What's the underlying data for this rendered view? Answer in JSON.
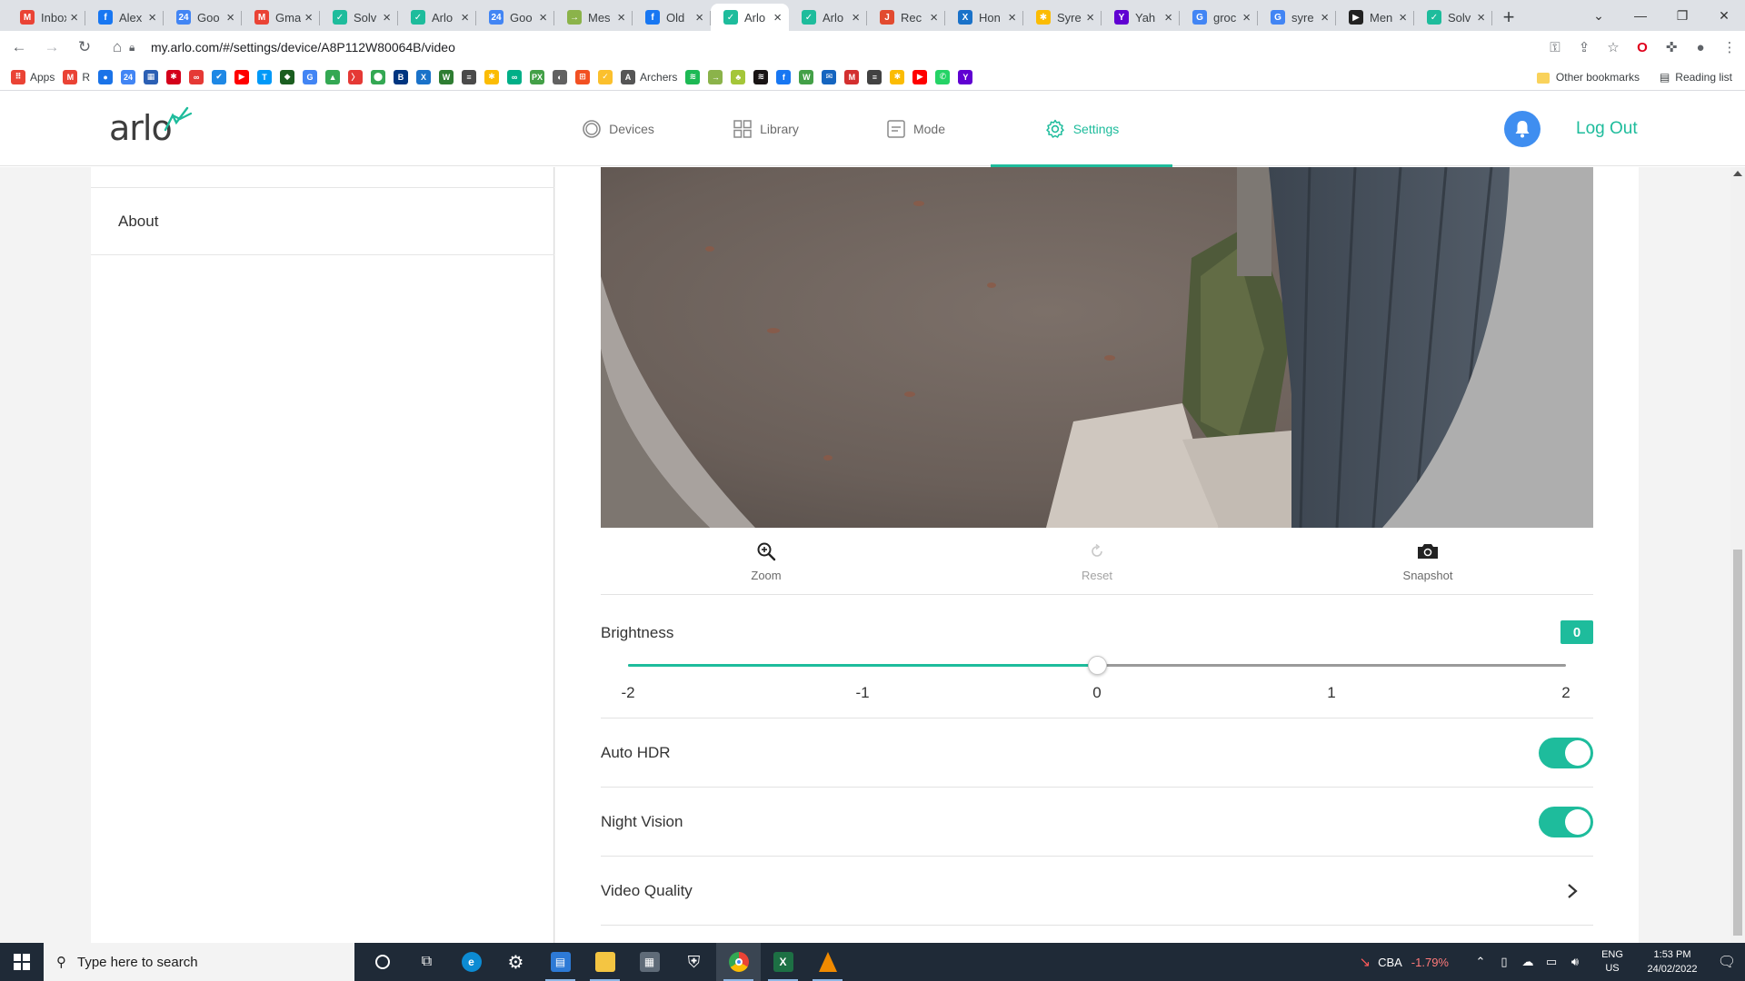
{
  "browser": {
    "tabs": [
      {
        "title": "Inbox",
        "icon": "gmail-icon",
        "color": "#ea4335",
        "glyph": "M"
      },
      {
        "title": "Alex",
        "icon": "facebook-icon",
        "color": "#1877f2",
        "glyph": "f"
      },
      {
        "title": "Goo",
        "icon": "calendar-icon",
        "color": "#4285f4",
        "glyph": "24"
      },
      {
        "title": "Gma",
        "icon": "gmail-icon",
        "color": "#ea4335",
        "glyph": "M"
      },
      {
        "title": "Solv",
        "icon": "arlo-icon",
        "color": "#1ebc9c",
        "glyph": "✓"
      },
      {
        "title": "Arlo",
        "icon": "arlo-icon",
        "color": "#1ebc9c",
        "glyph": "✓"
      },
      {
        "title": "Goo",
        "icon": "calendar-icon",
        "color": "#4285f4",
        "glyph": "24"
      },
      {
        "title": "Mes",
        "icon": "arlo-icon",
        "color": "#8bb34a",
        "glyph": "→"
      },
      {
        "title": "Old",
        "icon": "facebook-icon",
        "color": "#1877f2",
        "glyph": "f"
      },
      {
        "title": "Arlo",
        "icon": "arlo-icon",
        "color": "#1ebc9c",
        "glyph": "✓",
        "active": true
      },
      {
        "title": "Arlo",
        "icon": "arlo-icon",
        "color": "#1ebc9c",
        "glyph": "✓"
      },
      {
        "title": "Rec",
        "icon": "recipe-icon",
        "color": "#e24a2f",
        "glyph": "J"
      },
      {
        "title": "Hon",
        "icon": "xero-icon",
        "color": "#1a72c9",
        "glyph": "X"
      },
      {
        "title": "Syre",
        "icon": "photos-icon",
        "color": "#fbbc04",
        "glyph": "✱"
      },
      {
        "title": "Yah",
        "icon": "yahoo-icon",
        "color": "#6001d2",
        "glyph": "Y"
      },
      {
        "title": "groc",
        "icon": "google-icon",
        "color": "#4285f4",
        "glyph": "G"
      },
      {
        "title": "syre",
        "icon": "google-icon",
        "color": "#4285f4",
        "glyph": "G"
      },
      {
        "title": "Men",
        "icon": "menu-icon",
        "color": "#222222",
        "glyph": "▶"
      },
      {
        "title": "Solv",
        "icon": "arlo-icon",
        "color": "#1ebc9c",
        "glyph": "✓"
      }
    ],
    "url": "my.arlo.com/#/settings/device/A8P112W80064B/video",
    "bookmarks": [
      {
        "label": "Apps",
        "icon": "apps-grid-icon",
        "color": "#ea4335",
        "glyph": "⠿"
      },
      {
        "label": "R",
        "icon": "gmail-icon",
        "color": "#ea4335",
        "glyph": "M"
      },
      {
        "label": "",
        "icon": "bookmark-icon",
        "color": "#1a73e8",
        "glyph": "●"
      },
      {
        "label": "",
        "icon": "calendar-icon",
        "color": "#4285f4",
        "glyph": "24"
      },
      {
        "label": "",
        "icon": "bank-icon",
        "color": "#2b5fb4",
        "glyph": "▦"
      },
      {
        "label": "",
        "icon": "bookmark-icon",
        "color": "#d4001a",
        "glyph": "✱"
      },
      {
        "label": "",
        "icon": "bookmark-icon",
        "color": "#e53935",
        "glyph": "∞"
      },
      {
        "label": "",
        "icon": "todo-icon",
        "color": "#1e88e5",
        "glyph": "✔"
      },
      {
        "label": "",
        "icon": "youtube-icon",
        "color": "#ff0000",
        "glyph": "▶"
      },
      {
        "label": "",
        "icon": "telstra-icon",
        "color": "#0099f8",
        "glyph": "T"
      },
      {
        "label": "",
        "icon": "bookmark-icon",
        "color": "#1b5e20",
        "glyph": "◆"
      },
      {
        "label": "",
        "icon": "google-icon",
        "color": "#4285f4",
        "glyph": "G"
      },
      {
        "label": "",
        "icon": "drive-icon",
        "color": "#34a853",
        "glyph": "▲"
      },
      {
        "label": "",
        "icon": "bookmark-icon",
        "color": "#e53935",
        "glyph": "〉"
      },
      {
        "label": "",
        "icon": "maps-icon",
        "color": "#34a853",
        "glyph": "⬤"
      },
      {
        "label": "",
        "icon": "booking-icon",
        "color": "#003580",
        "glyph": "B"
      },
      {
        "label": "",
        "icon": "xero-icon",
        "color": "#1a72c9",
        "glyph": "X"
      },
      {
        "label": "",
        "icon": "bookmark-icon",
        "color": "#2e7d32",
        "glyph": "W"
      },
      {
        "label": "",
        "icon": "bookmark-icon",
        "color": "#4a4a4a",
        "glyph": "≡"
      },
      {
        "label": "",
        "icon": "photos-icon",
        "color": "#fbbc04",
        "glyph": "✱"
      },
      {
        "label": "",
        "icon": "tripadvisor-icon",
        "color": "#00af87",
        "glyph": "∞"
      },
      {
        "label": "",
        "icon": "bookmark-icon",
        "color": "#43a047",
        "glyph": "PX"
      },
      {
        "label": "",
        "icon": "bookmark-icon",
        "color": "#616161",
        "glyph": "◐"
      },
      {
        "label": "",
        "icon": "office-icon",
        "color": "#f25022",
        "glyph": "⊞"
      },
      {
        "label": "",
        "icon": "bookmark-icon",
        "color": "#fbc02d",
        "glyph": "✓"
      },
      {
        "label": "Archers",
        "icon": "archers-icon",
        "color": "#555555",
        "glyph": "A"
      },
      {
        "label": "",
        "icon": "spotify-icon",
        "color": "#1db954",
        "glyph": "≋"
      },
      {
        "label": "",
        "icon": "bookmark-icon",
        "color": "#8bb34a",
        "glyph": "→"
      },
      {
        "label": "",
        "icon": "android-icon",
        "color": "#a4c639",
        "glyph": "♣"
      },
      {
        "label": "",
        "icon": "spotify-icon",
        "color": "#191414",
        "glyph": "≋"
      },
      {
        "label": "",
        "icon": "facebook-icon",
        "color": "#1877f2",
        "glyph": "f"
      },
      {
        "label": "",
        "icon": "woolworths-icon",
        "color": "#43a047",
        "glyph": "W"
      },
      {
        "label": "",
        "icon": "bookmark-icon",
        "color": "#1565c0",
        "glyph": "✉"
      },
      {
        "label": "",
        "icon": "bookmark-icon",
        "color": "#d32f2f",
        "glyph": "M"
      },
      {
        "label": "",
        "icon": "bookmark-icon",
        "color": "#424242",
        "glyph": "≡"
      },
      {
        "label": "",
        "icon": "photos-icon",
        "color": "#fbbc04",
        "glyph": "✱"
      },
      {
        "label": "",
        "icon": "youtube-icon",
        "color": "#ff0000",
        "glyph": "▶"
      },
      {
        "label": "",
        "icon": "whatsapp-icon",
        "color": "#25d366",
        "glyph": "✆"
      },
      {
        "label": "",
        "icon": "yahoo-icon",
        "color": "#6001d2",
        "glyph": "Y"
      }
    ],
    "other_bookmarks": "Other bookmarks",
    "reading_list": "Reading list"
  },
  "header": {
    "logo": "arlo",
    "nav": [
      {
        "label": "Devices",
        "icon": "devices-icon",
        "active": false
      },
      {
        "label": "Library",
        "icon": "library-grid-icon",
        "active": false
      },
      {
        "label": "Mode",
        "icon": "mode-icon",
        "active": false
      },
      {
        "label": "Settings",
        "icon": "gear-icon",
        "active": true
      }
    ],
    "logout": "Log Out"
  },
  "sidebar": {
    "items": [
      {
        "label": "About"
      }
    ]
  },
  "camera_controls": {
    "zoom": "Zoom",
    "reset": "Reset",
    "snapshot": "Snapshot"
  },
  "brightness": {
    "label": "Brightness",
    "value": 0,
    "display_value": "0",
    "min": -2,
    "max": 2,
    "ticks": [
      "-2",
      "-1",
      "0",
      "1",
      "2"
    ]
  },
  "settings": {
    "auto_hdr": {
      "label": "Auto HDR",
      "enabled": true
    },
    "night_vision": {
      "label": "Night Vision",
      "enabled": true
    },
    "video_quality": {
      "label": "Video Quality"
    }
  },
  "accent_color": "#1ebc9c",
  "taskbar": {
    "search_placeholder": "Type here to search",
    "stock_name": "CBA",
    "stock_change": "-1.79%",
    "lang_line1": "ENG",
    "lang_line2": "US",
    "time": "1:53 PM",
    "date": "24/02/2022"
  }
}
